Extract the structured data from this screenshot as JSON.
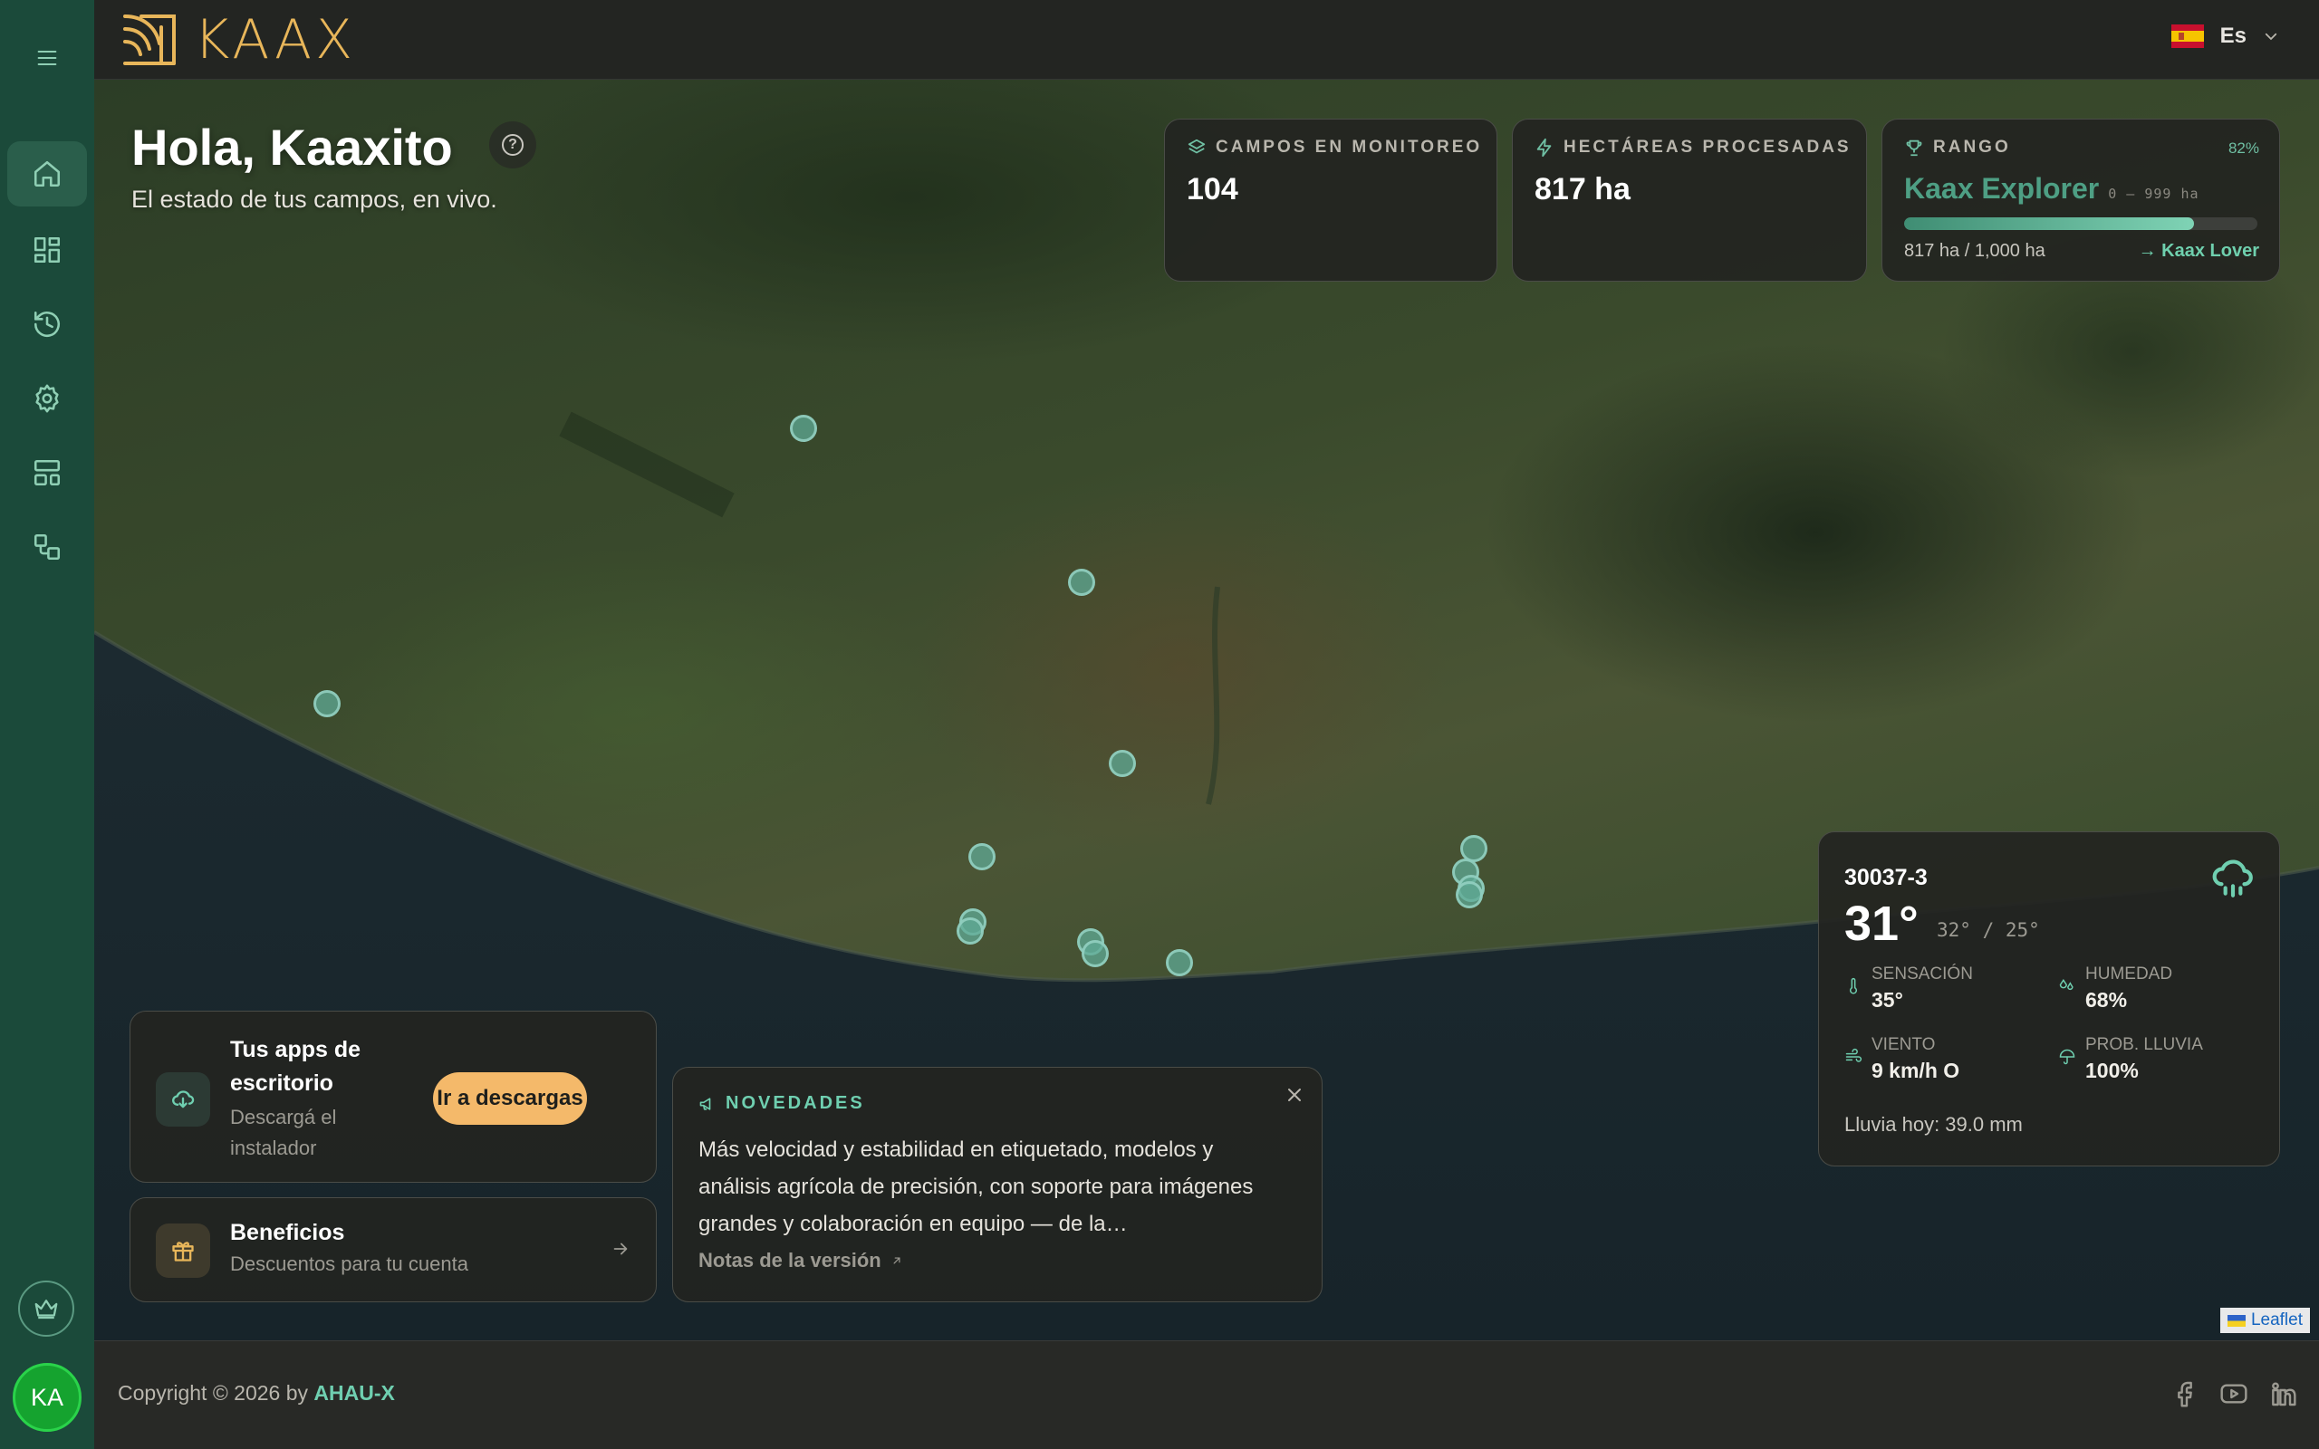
{
  "app": {
    "brand": "KAAX"
  },
  "topbar": {
    "language": "Es"
  },
  "greeting": {
    "title": "Hola, Kaaxito",
    "subtitle": "El estado de tus campos, en vivo."
  },
  "stats": {
    "fields_label": "CAMPOS EN MONITOREO",
    "fields_value": "104",
    "hectares_label": "HECTÁREAS PROCESADAS",
    "hectares_value": "817 ha"
  },
  "rank": {
    "label": "RANGO",
    "percent": "82%",
    "progress_fraction": 0.82,
    "name": "Kaax Explorer",
    "range": "0 – 999 ha",
    "progress_text": "817 ha / 1,000 ha",
    "next": "→ Kaax Lover"
  },
  "weather": {
    "field_id": "30037-3",
    "temp": "31°",
    "minmax": "32° / 25°",
    "feels_label": "SENSACIÓN",
    "feels_value": "35°",
    "humidity_label": "HUMEDAD",
    "humidity_value": "68%",
    "wind_label": "VIENTO",
    "wind_value": "9 km/h O",
    "rain_prob_label": "PROB. LLUVIA",
    "rain_prob_value": "100%",
    "rain_today": "Lluvia hoy: 39.0 mm"
  },
  "apps_card": {
    "title": "Tus apps de escritorio",
    "subtitle": "Descargá el instalador",
    "button": "Ir a descargas"
  },
  "benefits_card": {
    "title": "Beneficios",
    "subtitle": "Descuentos para tu cuenta"
  },
  "news": {
    "label": "NOVEDADES",
    "body": "Más velocidad y estabilidad en etiquetado, modelos y análisis agrícola de precisión, con soporte para imágenes grandes y colaboración en equipo — de la…",
    "link": "Notas de la versión"
  },
  "map": {
    "attribution": "Leaflet"
  },
  "sidebar": {
    "avatar_initials": "KA"
  },
  "footer": {
    "copyright_prefix": "Copyright © 2026 by ",
    "brand": "AHAU-X"
  },
  "colors": {
    "accent": "#6fcfb0",
    "brand_gold": "#e8b65a",
    "sidebar": "#1b4a3a",
    "button": "#f4b96a"
  }
}
